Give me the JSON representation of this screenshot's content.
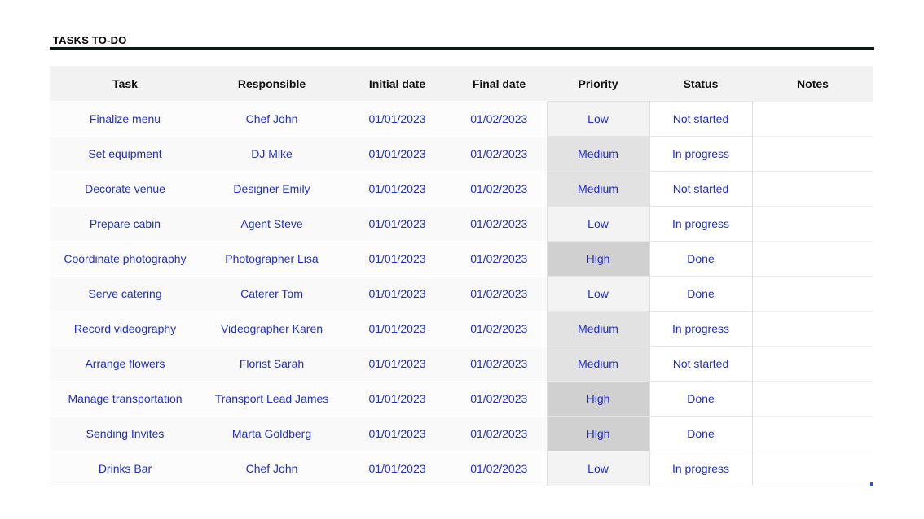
{
  "title": "TASKS TO-DO",
  "columns": [
    "Task",
    "Responsible",
    "Initial date",
    "Final date",
    "Priority",
    "Status",
    "Notes"
  ],
  "rows": [
    {
      "task": "Finalize menu",
      "responsible": "Chef John",
      "initial": "01/01/2023",
      "final": "01/02/2023",
      "priority": "Low",
      "status": "Not started",
      "notes": ""
    },
    {
      "task": "Set equipment",
      "responsible": "DJ Mike",
      "initial": "01/01/2023",
      "final": "01/02/2023",
      "priority": "Medium",
      "status": "In progress",
      "notes": ""
    },
    {
      "task": "Decorate venue",
      "responsible": "Designer Emily",
      "initial": "01/01/2023",
      "final": "01/02/2023",
      "priority": "Medium",
      "status": "Not started",
      "notes": ""
    },
    {
      "task": "Prepare cabin",
      "responsible": "Agent Steve",
      "initial": "01/01/2023",
      "final": "01/02/2023",
      "priority": "Low",
      "status": "In progress",
      "notes": ""
    },
    {
      "task": "Coordinate photography",
      "responsible": "Photographer Lisa",
      "initial": "01/01/2023",
      "final": "01/02/2023",
      "priority": "High",
      "status": "Done",
      "notes": ""
    },
    {
      "task": "Serve catering",
      "responsible": "Caterer Tom",
      "initial": "01/01/2023",
      "final": "01/02/2023",
      "priority": "Low",
      "status": "Done",
      "notes": ""
    },
    {
      "task": "Record videography",
      "responsible": "Videographer Karen",
      "initial": "01/01/2023",
      "final": "01/02/2023",
      "priority": "Medium",
      "status": "In progress",
      "notes": ""
    },
    {
      "task": "Arrange flowers",
      "responsible": "Florist Sarah",
      "initial": "01/01/2023",
      "final": "01/02/2023",
      "priority": "Medium",
      "status": "Not started",
      "notes": ""
    },
    {
      "task": "Manage transportation",
      "responsible": "Transport Lead James",
      "initial": "01/01/2023",
      "final": "01/02/2023",
      "priority": "High",
      "status": "Done",
      "notes": ""
    },
    {
      "task": "Sending Invites",
      "responsible": "Marta Goldberg",
      "initial": "01/01/2023",
      "final": "01/02/2023",
      "priority": "High",
      "status": "Done",
      "notes": ""
    },
    {
      "task": "Drinks Bar",
      "responsible": "Chef John",
      "initial": "01/01/2023",
      "final": "01/02/2023",
      "priority": "Low",
      "status": "In progress",
      "notes": ""
    }
  ],
  "colors": {
    "text": "#1f2ec9",
    "priority_low": "#f3f3f3",
    "priority_medium": "#e2e2e2",
    "priority_high": "#d0d0d0"
  }
}
